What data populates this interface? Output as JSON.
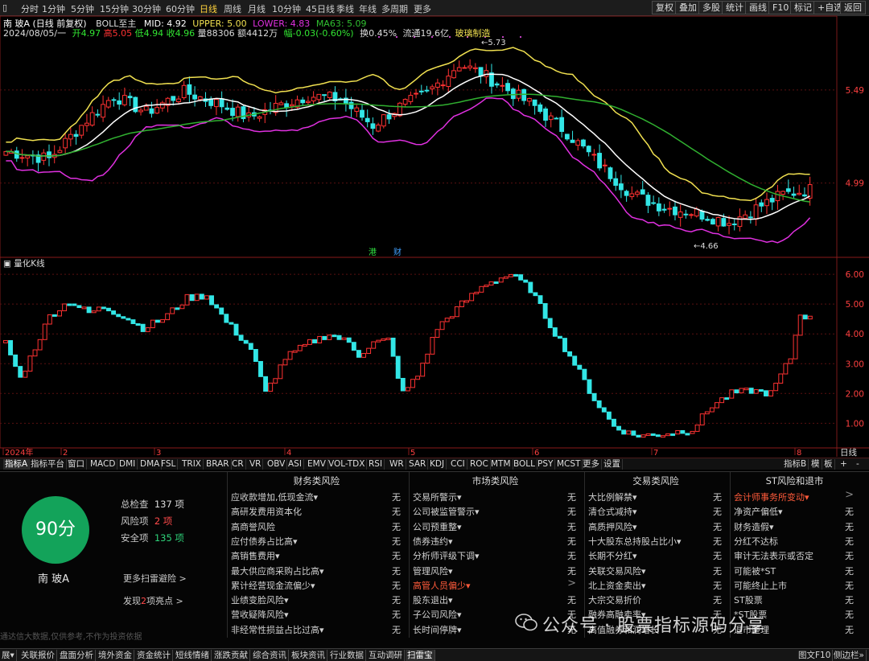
{
  "toolbar": {
    "periods": [
      "分时",
      "1分钟",
      "5分钟",
      "15分钟",
      "30分钟",
      "60分钟",
      "日线",
      "周线",
      "月线",
      "10分钟",
      "45日线",
      "季线",
      "年线",
      "多周期",
      "更多"
    ],
    "active_period": "日线",
    "right_buttons": [
      "复权",
      "叠加",
      "多股",
      "统计",
      "画线",
      "F10",
      "标记",
      "+自选",
      "返回"
    ]
  },
  "header": {
    "stock_title": "南 玻A (日线 前复权)",
    "indicator": "BOLL至主",
    "mid": "MID: 4.92",
    "upper": "UPPER: 5.00",
    "lower": "LOWER: 4.83",
    "ma63": "MA63: 5.09",
    "date": "2024/08/05/一",
    "open": "开4.97",
    "high": "高5.05",
    "low": "低4.94",
    "close": "收4.96",
    "volume": "量88306",
    "amount": "额4412万",
    "change": "幅-0.03(-0.60%)",
    "turnover": "换0.45%",
    "float_cap": "流通19.6亿",
    "sector": "玻璃制造"
  },
  "colors": {
    "up": "#ff3232",
    "down": "#32e6e6",
    "upper": "#f0e050",
    "mid": "#ffffff",
    "lower": "#e030e0",
    "ma63": "#30b030",
    "active": "#ffd23c"
  },
  "chart_data": [
    {
      "type": "candlestick",
      "title": "日线",
      "y_ticks": [
        "5.49",
        "4.99"
      ],
      "annotations": [
        "5.73",
        "4.66",
        "港",
        "财"
      ],
      "x_ticks": [
        "2024年",
        "2",
        "3",
        "4",
        "5",
        "6",
        "7",
        "8"
      ],
      "y_range": [
        4.6,
        5.8
      ],
      "series": [
        {
          "name": "BOLL UPPER"
        },
        {
          "name": "BOLL MID"
        },
        {
          "name": "BOLL LOWER"
        },
        {
          "name": "MA63"
        }
      ]
    },
    {
      "type": "candlestick",
      "title": "量化K线",
      "y_ticks": [
        "6.00",
        "5.00",
        "4.00",
        "3.00",
        "2.00",
        "1.00"
      ],
      "y_range": [
        0.2,
        6.3
      ]
    }
  ],
  "subtabs": {
    "left": [
      "指标A",
      "指标平台",
      "窗口",
      "MACD",
      "DMI",
      "DMA",
      "FSL",
      "TRIX",
      "BRAR",
      "CR",
      "VR",
      "OBV",
      "ASI",
      "EMV",
      "VOL-TDX",
      "RSI",
      "WR",
      "SAR",
      "KDJ",
      "CCI",
      "ROC",
      "MTM",
      "BOLL",
      "PSY",
      "MCST",
      "更多",
      "设置"
    ],
    "right": [
      "指标B",
      "模",
      "板"
    ],
    "axis_label": "日线",
    "axis_btns": [
      "+",
      "-"
    ]
  },
  "risk_panel": {
    "score": "90分",
    "stock_name": "南 玻A",
    "total_label": "总检查",
    "total_value": "137 项",
    "risk_label": "风险项",
    "risk_value": "2 项",
    "safe_label": "安全项",
    "safe_value": "135 项",
    "more_link": "更多扫雷避险 >",
    "highlight_prefix": "发现",
    "highlight_num": "2",
    "highlight_suffix": "项亮点 >",
    "footnote": "通达信大数据,仅供参考,不作为投资依据",
    "columns": [
      {
        "title": "财务类风险",
        "rows": [
          {
            "name": "应收款增加,低现金流▾",
            "val": "无"
          },
          {
            "name": "高研发费用资本化",
            "val": "无"
          },
          {
            "name": "高商誉风险",
            "val": "无"
          },
          {
            "name": "应付债券占比高▾",
            "val": "无"
          },
          {
            "name": "高销售费用▾",
            "val": "无"
          },
          {
            "name": "最大供应商采购占比高▾",
            "val": "无"
          },
          {
            "name": "累计经营现金流偏少▾",
            "val": "无"
          },
          {
            "name": "业绩变脸风险▾",
            "val": "无"
          },
          {
            "name": "营收疑降风险▾",
            "val": "无"
          },
          {
            "name": "非经常性损益占比过高▾",
            "val": "无"
          }
        ]
      },
      {
        "title": "市场类风险",
        "rows": [
          {
            "name": "交易所警示▾",
            "val": "无"
          },
          {
            "name": "公司被监管警示▾",
            "val": "无"
          },
          {
            "name": "公司预重整▾",
            "val": "无"
          },
          {
            "name": "债券违约▾",
            "val": "无"
          },
          {
            "name": "分析师评级下调▾",
            "val": "无"
          },
          {
            "name": "管理风险▾",
            "val": "无"
          },
          {
            "name": "高管人员偏少▾",
            "val": ">",
            "hl": true
          },
          {
            "name": "股东退出▾",
            "val": "无"
          },
          {
            "name": "子公司风险▾",
            "val": "无"
          },
          {
            "name": "长时间停牌▾",
            "val": "无"
          }
        ]
      },
      {
        "title": "交易类风险",
        "rows": [
          {
            "name": "大比例解禁▾",
            "val": "无"
          },
          {
            "name": "清仓式减持▾",
            "val": "无"
          },
          {
            "name": "高质押风险▾",
            "val": "无"
          },
          {
            "name": "十大股东总持股占比小▾",
            "val": "无"
          },
          {
            "name": "长期不分红▾",
            "val": "无"
          },
          {
            "name": "关联交易风险▾",
            "val": "无"
          },
          {
            "name": "北上资金卖出▾",
            "val": "无"
          },
          {
            "name": "大宗交易折价",
            "val": "无"
          },
          {
            "name": "融券高融卖率▾",
            "val": "无"
          },
          {
            "name": "高值融券和润增长",
            "val": "无"
          }
        ]
      },
      {
        "title": "ST风险和退市",
        "rows": [
          {
            "name": "会计师事务所变动▾",
            "val": ">",
            "hl": true
          },
          {
            "name": "净资产偏低▾",
            "val": "无"
          },
          {
            "name": "财务造假▾",
            "val": "无"
          },
          {
            "name": "分红不达标",
            "val": "无"
          },
          {
            "name": "审计无法表示或否定",
            "val": "无"
          },
          {
            "name": "可能被*ST",
            "val": "无"
          },
          {
            "name": "可能终止上市",
            "val": "无"
          },
          {
            "name": "ST股票",
            "val": "无"
          },
          {
            "name": "*ST股票",
            "val": "无"
          },
          {
            "name": "退市整理",
            "val": "无"
          }
        ]
      }
    ]
  },
  "watermark": "公众号 · 股票指标源码分享",
  "bottom_tabs": {
    "items": [
      "展▾",
      "关联报价",
      "盘面分析",
      "境外资金",
      "资金统计",
      "短线情绪",
      "涨跌贡献",
      "综合资讯",
      "板块资讯",
      "行业数据",
      "互动调研",
      "扫雷宝"
    ],
    "active": "扫雷宝",
    "right": [
      "图文F10",
      "侧边栏»"
    ]
  }
}
